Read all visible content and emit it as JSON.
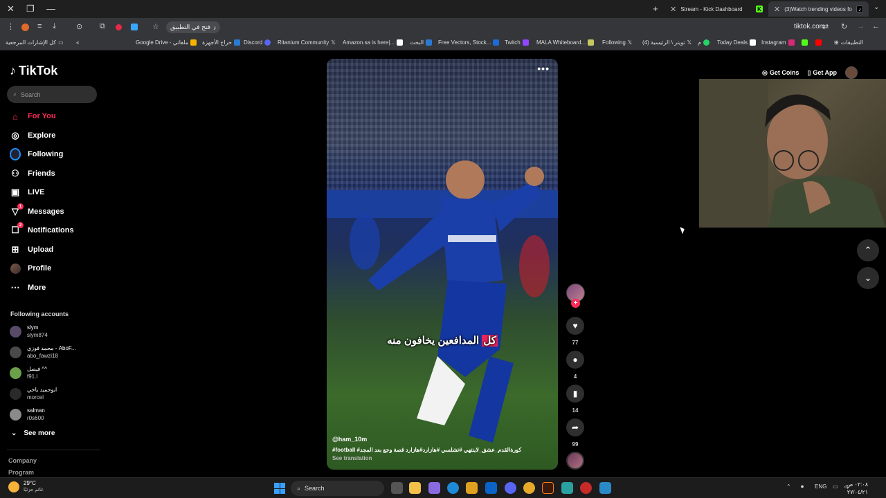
{
  "browser": {
    "tabs": [
      {
        "label": "Stream - Kick Dashboard",
        "active": false
      },
      {
        "label": "(3)Watch trending videos fo",
        "active": true
      }
    ],
    "url": "tiktok.com",
    "omnibox_chip": "فتح في التطبيق",
    "bookmarks": [
      "كل الإشارات المرجعية",
      "Google Drive - ملفاتي",
      "حراج الأجهزة",
      "Discord",
      "Ritanium Community",
      "Amazon.sa is here|...",
      "البحث",
      "Free Vectors, Stock...",
      "Twitch",
      "MALA Whiteboard...",
      "Following",
      "(4) تويتر \\ الرئيسية",
      "م",
      "Today Deals",
      "Instagram",
      "التطبيقات"
    ]
  },
  "sidebar": {
    "brand": "TikTok",
    "search_placeholder": "Search",
    "nav": [
      {
        "label": "For You",
        "icon": "home-icon",
        "active": true
      },
      {
        "label": "Explore",
        "icon": "compass-icon"
      },
      {
        "label": "Following",
        "icon": "following-icon"
      },
      {
        "label": "Friends",
        "icon": "friends-icon"
      },
      {
        "label": "LIVE",
        "icon": "live-icon"
      },
      {
        "label": "Messages",
        "icon": "messages-icon",
        "badge": "1"
      },
      {
        "label": "Notifications",
        "icon": "notifications-icon",
        "badge": "2"
      },
      {
        "label": "Upload",
        "icon": "upload-icon"
      },
      {
        "label": "Profile",
        "icon": "profile-icon"
      },
      {
        "label": "More",
        "icon": "more-icon"
      }
    ],
    "following_title": "Following accounts",
    "accounts": [
      {
        "name": "slym",
        "username": "slym874"
      },
      {
        "name": "محمد فوزي - AboF...",
        "username": "abo_fawzi18"
      },
      {
        "name": "فيصل ^^",
        "username": "f91.l"
      },
      {
        "name": "ابوحميد ياخي",
        "username": "morcel"
      },
      {
        "name": "salman",
        "username": "r0s600"
      }
    ],
    "see_more": "See more",
    "footer": [
      "Company",
      "Program"
    ]
  },
  "video": {
    "overlay_text_highlight": "كل",
    "overlay_text_rest": " المدافعين يخافون منه",
    "author": "@ham_10m",
    "caption": "#football #كورةالقدم_عشق_لاينتهي #تشلسي #هازارد#هازارد قصة وجع بعد المجد",
    "see_translation": "See translation"
  },
  "actions": {
    "likes": "77",
    "comments": "4",
    "saves": "14",
    "shares": "99"
  },
  "top_right": {
    "get_coins": "Get Coins",
    "get_app": "Get App"
  },
  "taskbar": {
    "temperature": "29°C",
    "weather_desc": "غائم جزئيًا",
    "search": "Search",
    "language": "ENG",
    "time": "٠٢:٠٨ ص",
    "date": "٢٧/٠٤/٢١"
  }
}
